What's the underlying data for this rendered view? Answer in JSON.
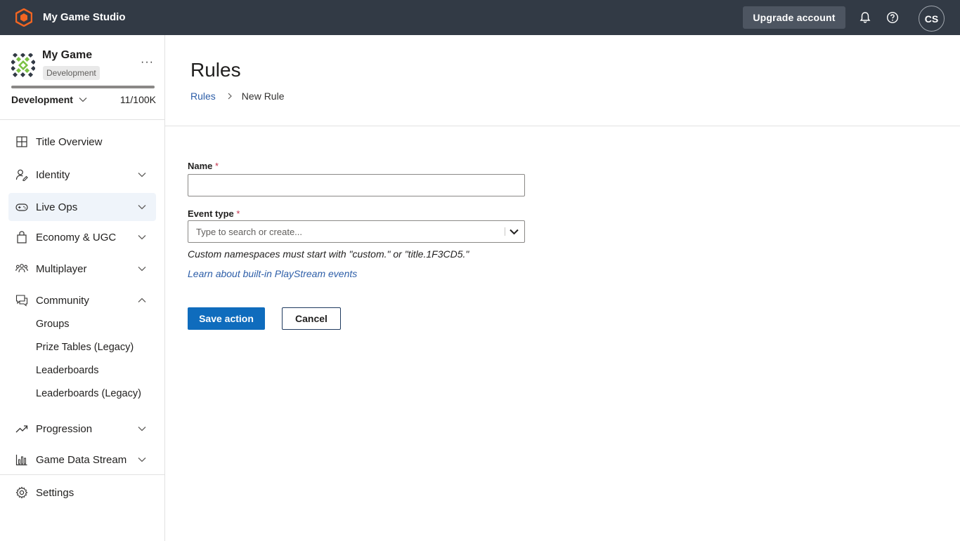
{
  "topbar": {
    "studio_name": "My Game Studio",
    "upgrade_label": "Upgrade account",
    "avatar_initials": "CS",
    "logo_color": "#f26522"
  },
  "sidebar": {
    "game_name": "My Game",
    "environment_badge": "Development",
    "environment_selected": "Development",
    "usage": "11/100K",
    "usage_fraction": 0.00011,
    "items": [
      {
        "label": "Title Overview",
        "icon": "grid-icon",
        "expandable": false
      },
      {
        "label": "Identity",
        "icon": "identity-icon",
        "expandable": true
      },
      {
        "label": "Live Ops",
        "icon": "gamepad-icon",
        "expandable": true,
        "active": true
      },
      {
        "label": "Economy & UGC",
        "icon": "bag-icon",
        "expandable": true
      },
      {
        "label": "Multiplayer",
        "icon": "people-icon",
        "expandable": true
      },
      {
        "label": "Community",
        "icon": "chat-icon",
        "expandable": true,
        "expanded": true
      },
      {
        "label": "Progression",
        "icon": "trend-icon",
        "expandable": true
      },
      {
        "label": "Game Data Stream",
        "icon": "bar-chart-icon",
        "expandable": true
      }
    ],
    "community_children": [
      "Groups",
      "Prize Tables (Legacy)",
      "Leaderboards",
      "Leaderboards (Legacy)"
    ],
    "settings_label": "Settings"
  },
  "main": {
    "title": "Rules",
    "breadcrumb": {
      "link": "Rules",
      "current": "New Rule"
    },
    "form": {
      "name_label": "Name",
      "name_value": "",
      "event_type_label": "Event type",
      "event_type_placeholder": "Type to search or create...",
      "required_marker": "*",
      "hint": "Custom namespaces must start with \"custom.\" or \"title.1F3CD5.\"",
      "learn_link": "Learn about built-in PlayStream events",
      "save_label": "Save action",
      "cancel_label": "Cancel"
    }
  },
  "colors": {
    "topbar_bg": "#323a45",
    "primary": "#0f6cbd",
    "link": "#2d5ea8",
    "required": "#c4314b",
    "active_nav_bg": "#eff4fa"
  }
}
